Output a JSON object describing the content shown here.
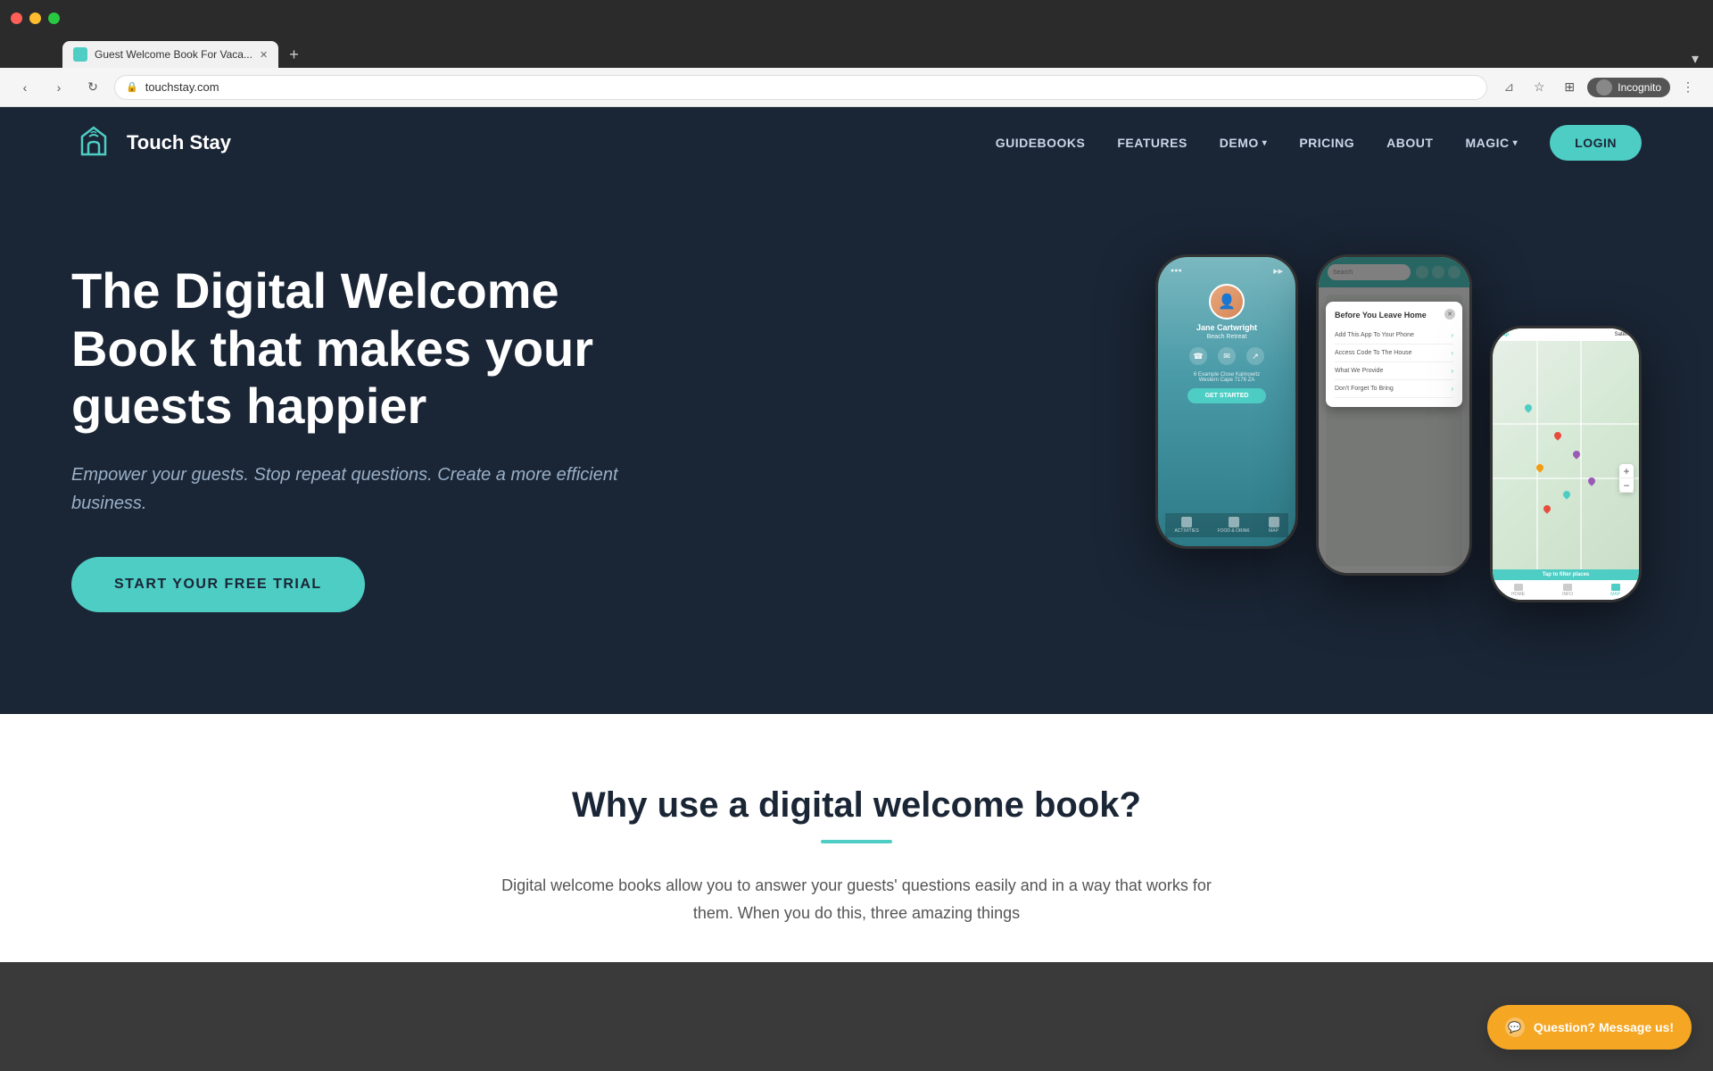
{
  "browser": {
    "tab_title": "Guest Welcome Book For Vaca...",
    "url": "touchstay.com",
    "window_controls": {
      "close": "●",
      "minimize": "●",
      "maximize": "●"
    },
    "incognito_label": "Incognito"
  },
  "nav": {
    "logo_text": "Touch Stay",
    "links": [
      {
        "label": "GUIDEBOOKS",
        "id": "guidebooks"
      },
      {
        "label": "FEATURES",
        "id": "features"
      },
      {
        "label": "DEMO",
        "id": "demo",
        "dropdown": true
      },
      {
        "label": "PRICING",
        "id": "pricing"
      },
      {
        "label": "ABOUT",
        "id": "about"
      },
      {
        "label": "MAGIC",
        "id": "magic",
        "dropdown": true
      }
    ],
    "login_label": "LOGIN"
  },
  "hero": {
    "title": "The Digital Welcome Book that makes your guests happier",
    "subtitle": "Empower your guests. Stop repeat questions. Create a more efficient business.",
    "cta_label": "START YOUR FREE TRIAL"
  },
  "phone_left": {
    "name": "Jane Cartwright",
    "property": "Beach Retreat",
    "address": "6 Example Close Kalmowitz\nWestern Cape 7176 ZA",
    "get_started": "GET STARTED",
    "nav_items": [
      "ACTIVITIES",
      "FOOD & DRINK",
      "MAP"
    ]
  },
  "phone_center": {
    "search_placeholder": "Search",
    "modal_title": "Before You Leave Home",
    "items": [
      "Add This App To Your Phone",
      "Access Code To The House",
      "What We Provide",
      "Don't Forget To Bring"
    ]
  },
  "phone_right": {
    "header_items": [
      "Map",
      "Satellite"
    ],
    "filter_label": "Tap to filter places",
    "nav_items": [
      "HOME",
      "INFO",
      "MAP"
    ]
  },
  "white_section": {
    "title": "Why use a digital welcome book?",
    "text": "Digital welcome books allow you to answer your guests' questions easily and in a way that works for them. When you do this, three amazing things"
  },
  "chat_widget": {
    "label": "Question? Message us!"
  }
}
